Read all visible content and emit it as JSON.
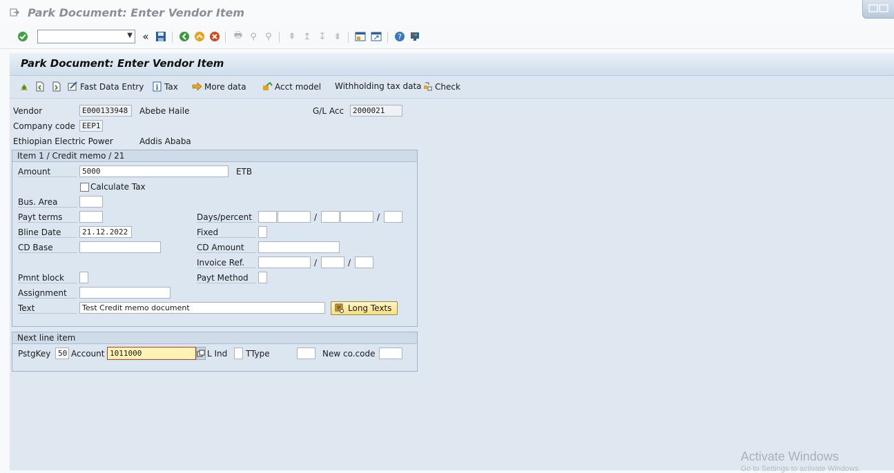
{
  "window": {
    "title": "Park Document: Enter Vendor Item"
  },
  "screen": {
    "title": "Park Document: Enter Vendor Item"
  },
  "app_toolbar": {
    "fast_data_entry": "Fast Data Entry",
    "tax": "Tax",
    "more_data": "More data",
    "acct_model": "Acct model",
    "withholding": "Withholding tax data",
    "check": "Check"
  },
  "header": {
    "vendor_label": "Vendor",
    "vendor_value": "E000133948",
    "vendor_name": "Abebe Haile",
    "gl_label": "G/L Acc",
    "gl_value": "2000021",
    "company_label": "Company code",
    "company_value": "EEP1",
    "company_name": "Ethiopian Electric Power",
    "city": "Addis Ababa"
  },
  "item": {
    "title": "Item 1 / Credit memo / 21",
    "amount_label": "Amount",
    "amount_value": "5000",
    "currency": "ETB",
    "calc_tax_label": "Calculate Tax",
    "bus_area_label": "Bus. Area",
    "payt_terms_label": "Payt terms",
    "days_percent_label": "Days/percent",
    "bline_label": "Bline Date",
    "bline_value": "21.12.2022",
    "fixed_label": "Fixed",
    "cd_base_label": "CD Base",
    "cd_amount_label": "CD Amount",
    "invoice_ref_label": "Invoice Ref.",
    "pmnt_block_label": "Pmnt block",
    "payt_method_label": "Payt Method",
    "assignment_label": "Assignment",
    "text_label": "Text",
    "text_value": "Test Credit memo document",
    "long_texts": "Long Texts",
    "slash": "/"
  },
  "next_item": {
    "title": "Next line item",
    "pstgkey_label": "PstgKey",
    "pstgkey_value": "50",
    "account_label": "Account",
    "account_value": "1011000",
    "lind_label": "L Ind",
    "ttype_label": "TType",
    "newco_label": "New co.code"
  },
  "watermark": {
    "line1": "Activate Windows",
    "line2": "Go to Settings to activate Windows."
  }
}
